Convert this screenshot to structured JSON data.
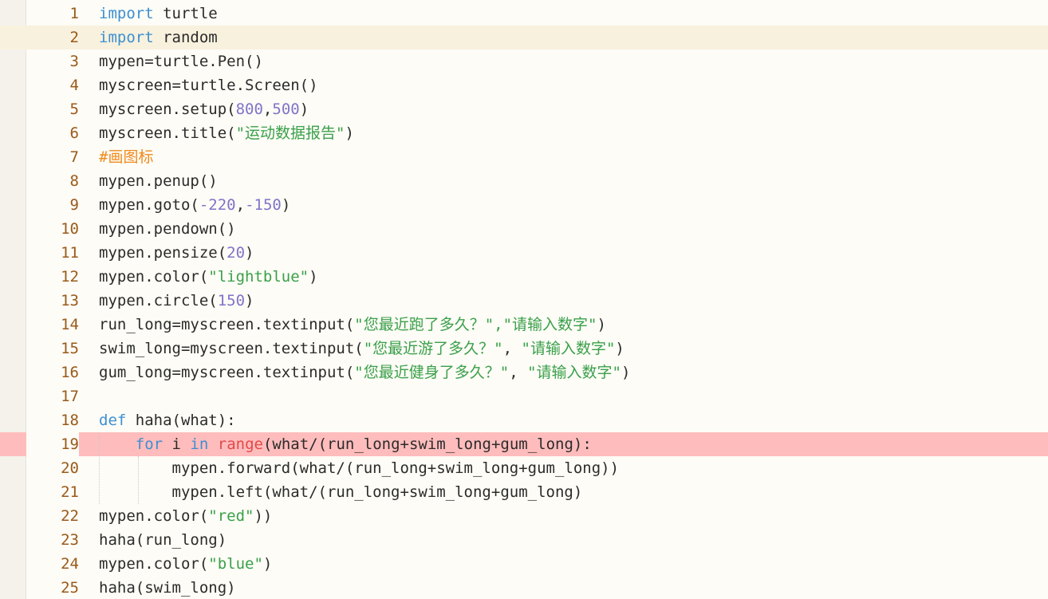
{
  "editor": {
    "language": "python",
    "current_line": 2,
    "error_line": 19,
    "colors": {
      "keyword": "#3d8fd1",
      "number": "#7f74c9",
      "string": "#3aa04a",
      "comment": "#f08a1c",
      "builtin": "#e24949",
      "error_highlight": "#ffbcbc",
      "current_line_highlight": "#f8f1de"
    },
    "lines": [
      {
        "n": "1",
        "tokens": [
          {
            "t": "import",
            "c": "kw"
          },
          {
            "t": " turtle"
          }
        ]
      },
      {
        "n": "2",
        "tokens": [
          {
            "t": "import",
            "c": "kw"
          },
          {
            "t": " random"
          }
        ]
      },
      {
        "n": "3",
        "tokens": [
          {
            "t": "mypen=turtle.Pen()"
          }
        ]
      },
      {
        "n": "4",
        "tokens": [
          {
            "t": "myscreen=turtle.Screen()"
          }
        ]
      },
      {
        "n": "5",
        "tokens": [
          {
            "t": "myscreen.setup("
          },
          {
            "t": "800",
            "c": "num"
          },
          {
            "t": ","
          },
          {
            "t": "500",
            "c": "num"
          },
          {
            "t": ")"
          }
        ]
      },
      {
        "n": "6",
        "tokens": [
          {
            "t": "myscreen.title("
          },
          {
            "t": "\"运动数据报告\"",
            "c": "str"
          },
          {
            "t": ")"
          }
        ]
      },
      {
        "n": "7",
        "tokens": [
          {
            "t": "#画图标",
            "c": "cmt"
          }
        ]
      },
      {
        "n": "8",
        "tokens": [
          {
            "t": "mypen.penup()"
          }
        ]
      },
      {
        "n": "9",
        "tokens": [
          {
            "t": "mypen.goto("
          },
          {
            "t": "-220",
            "c": "num"
          },
          {
            "t": ","
          },
          {
            "t": "-150",
            "c": "num"
          },
          {
            "t": ")"
          }
        ]
      },
      {
        "n": "10",
        "tokens": [
          {
            "t": "mypen.pendown()"
          }
        ]
      },
      {
        "n": "11",
        "tokens": [
          {
            "t": "mypen.pensize("
          },
          {
            "t": "20",
            "c": "num"
          },
          {
            "t": ")"
          }
        ]
      },
      {
        "n": "12",
        "tokens": [
          {
            "t": "mypen.color("
          },
          {
            "t": "\"lightblue\"",
            "c": "str"
          },
          {
            "t": ")"
          }
        ]
      },
      {
        "n": "13",
        "tokens": [
          {
            "t": "mypen.circle("
          },
          {
            "t": "150",
            "c": "num"
          },
          {
            "t": ")"
          }
        ]
      },
      {
        "n": "14",
        "tokens": [
          {
            "t": "run_long=myscreen.textinput("
          },
          {
            "t": "\"您最近跑了多久？\",\"请输入数字\"",
            "c": "str"
          },
          {
            "t": ")"
          }
        ]
      },
      {
        "n": "15",
        "tokens": [
          {
            "t": "swim_long=myscreen.textinput("
          },
          {
            "t": "\"您最近游了多久？\"",
            "c": "str"
          },
          {
            "t": ", "
          },
          {
            "t": "\"请输入数字\"",
            "c": "str"
          },
          {
            "t": ")"
          }
        ]
      },
      {
        "n": "16",
        "tokens": [
          {
            "t": "gum_long=myscreen.textinput("
          },
          {
            "t": "\"您最近健身了多久？\"",
            "c": "str"
          },
          {
            "t": ", "
          },
          {
            "t": "\"请输入数字\"",
            "c": "str"
          },
          {
            "t": ")"
          }
        ]
      },
      {
        "n": "17",
        "tokens": []
      },
      {
        "n": "18",
        "tokens": [
          {
            "t": "def",
            "c": "kw"
          },
          {
            "t": " haha(what):"
          }
        ]
      },
      {
        "n": "19",
        "tokens": [
          {
            "t": "    "
          },
          {
            "t": "for",
            "c": "kw"
          },
          {
            "t": " i "
          },
          {
            "t": "in",
            "c": "kw"
          },
          {
            "t": " "
          },
          {
            "t": "range",
            "c": "bi"
          },
          {
            "t": "(what/(run_long+swim_long+gum_long):"
          }
        ]
      },
      {
        "n": "20",
        "tokens": [
          {
            "t": "        mypen.forward(what/(run_long+swim_long+gum_long))"
          }
        ]
      },
      {
        "n": "21",
        "tokens": [
          {
            "t": "        mypen.left(what/(run_long+swim_long+gum_long)"
          }
        ]
      },
      {
        "n": "22",
        "tokens": [
          {
            "t": "mypen.color("
          },
          {
            "t": "\"red\"",
            "c": "str"
          },
          {
            "t": "))"
          }
        ]
      },
      {
        "n": "23",
        "tokens": [
          {
            "t": "haha(run_long)"
          }
        ]
      },
      {
        "n": "24",
        "tokens": [
          {
            "t": "mypen.color("
          },
          {
            "t": "\"blue\"",
            "c": "str"
          },
          {
            "t": ")"
          }
        ]
      },
      {
        "n": "25",
        "tokens": [
          {
            "t": "haha(swim_long)"
          }
        ]
      }
    ]
  }
}
